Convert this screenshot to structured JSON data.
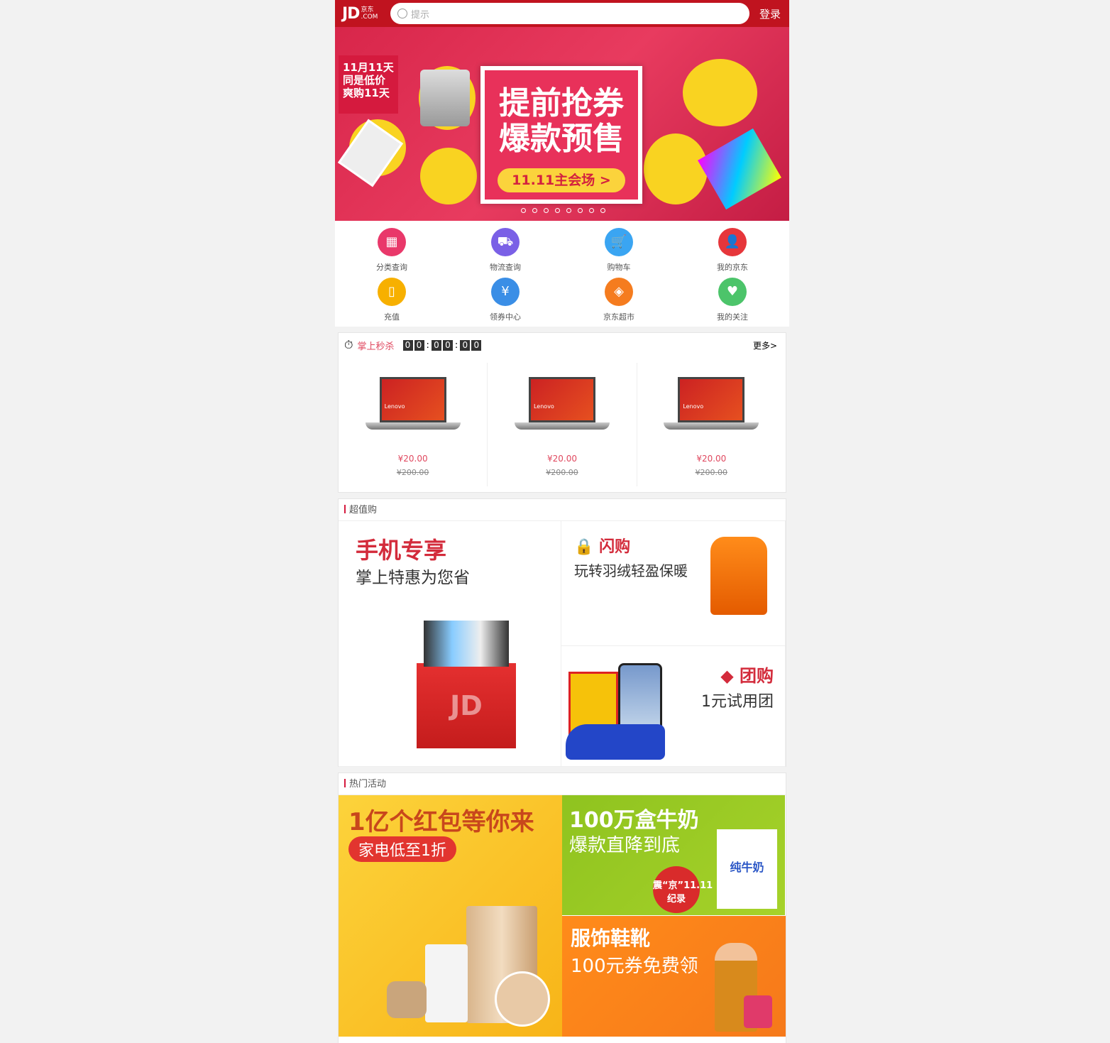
{
  "header": {
    "logo": "JD",
    "logo_cn": "京东",
    "logo_com": ".COM",
    "search_placeholder": "提示",
    "login": "登录"
  },
  "banner": {
    "tag_line1": "11月11天",
    "tag_line2": "同是低价",
    "tag_line3": "爽购11天",
    "title_line1": "提前抢券",
    "title_line2": "爆款预售",
    "button": "11.11主会场 >",
    "slide_count": 8,
    "active_slide": 1
  },
  "nav": [
    {
      "label": "分类查询",
      "icon": "grid-icon",
      "color": "#e9386a"
    },
    {
      "label": "物流查询",
      "icon": "truck-icon",
      "color": "#7a60e6"
    },
    {
      "label": "购物车",
      "icon": "cart-icon",
      "color": "#3aa5f2"
    },
    {
      "label": "我的京东",
      "icon": "user-icon",
      "color": "#e6363b"
    },
    {
      "label": "充值",
      "icon": "phone-icon",
      "color": "#f7b000"
    },
    {
      "label": "领券中心",
      "icon": "coupon-icon",
      "color": "#3a8ee6"
    },
    {
      "label": "京东超市",
      "icon": "tag-icon",
      "color": "#f57c1f"
    },
    {
      "label": "我的关注",
      "icon": "heart-icon",
      "color": "#4cc46a"
    }
  ],
  "seckill": {
    "title": "掌上秒杀",
    "timer": [
      "0",
      "0",
      "0",
      "0",
      "0",
      "0"
    ],
    "more": "更多>",
    "items": [
      {
        "price": "¥20.00",
        "old_price": "¥200.00",
        "brand": "Lenovo"
      },
      {
        "price": "¥20.00",
        "old_price": "¥200.00",
        "brand": "Lenovo"
      },
      {
        "price": "¥20.00",
        "old_price": "¥200.00",
        "brand": "Lenovo"
      }
    ]
  },
  "value": {
    "title": "超值购",
    "phone_title": "手机专享",
    "phone_sub": "掌上特惠为您省",
    "flash_title": "闪购",
    "flash_sub": "玩转羽绒轻盈保暖",
    "group_title": "团购",
    "group_sub": "1元试用团",
    "box_logo": "JD"
  },
  "hot": {
    "title": "热门活动",
    "milk_title": "100万盒牛奶",
    "milk_sub": "爆款直降到底",
    "milk_badge": "震“京”11.11纪录",
    "milk_pack": "纯牛奶",
    "red_title": "1亿个红包等你来",
    "red_sub": "家电低至1折",
    "cloth_title": "服饰鞋靴",
    "cloth_sub": "100元券免费领"
  }
}
